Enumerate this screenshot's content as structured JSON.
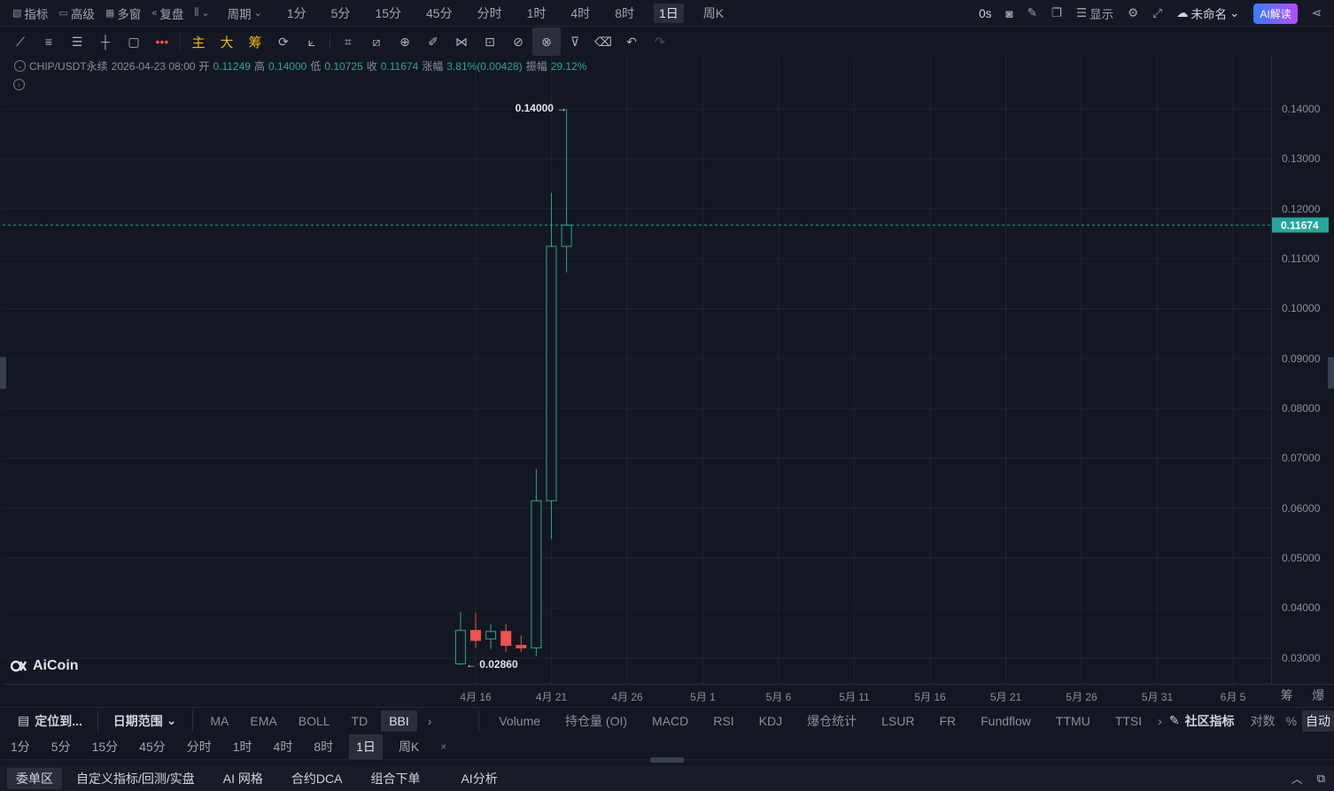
{
  "topbar": {
    "indicators_label": "指标",
    "advanced_label": "高级",
    "multiwindow_label": "多窗",
    "replay_label": "复盘",
    "period_label": "周期",
    "periods": [
      "1分",
      "5分",
      "15分",
      "45分",
      "分时",
      "1时",
      "4时",
      "8时",
      "1日",
      "周K"
    ],
    "active_period": "1日",
    "timer": "0s",
    "display_label": "显示",
    "layout_name": "未命名",
    "ai_button": "AI解读"
  },
  "drawbar": {
    "cn_tools": [
      "主",
      "大",
      "筹"
    ]
  },
  "legend": {
    "symbol": "CHIP/USDT永续",
    "datetime": "2026-04-23 08:00",
    "open_label": "开",
    "open": "0.11249",
    "high_label": "高",
    "high": "0.14000",
    "low_label": "低",
    "low": "0.10725",
    "close_label": "收",
    "close": "0.11674",
    "change_label": "涨幅",
    "change": "3.81%(0.00428)",
    "amp_label": "振幅",
    "amp": "29.12%"
  },
  "chart_data": {
    "type": "candlestick",
    "symbol": "CHIP/USDT永续",
    "interval": "1日",
    "y_ticks": [
      "0.14000",
      "0.13000",
      "0.12000",
      "0.11000",
      "0.10000",
      "0.09000",
      "0.08000",
      "0.07000",
      "0.06000",
      "0.05000",
      "0.04000",
      "0.03000"
    ],
    "ylim": [
      0.0248,
      0.1505
    ],
    "x_ticks": [
      "4月 16",
      "4月 21",
      "4月 26",
      "5月 1",
      "5月 6",
      "5月 11",
      "5月 16",
      "5月 21",
      "5月 26",
      "5月 31",
      "6月 5"
    ],
    "candles": [
      {
        "date": "2026-04-15",
        "open": 0.0288,
        "high": 0.0392,
        "low": 0.0286,
        "close": 0.0355
      },
      {
        "date": "2026-04-16",
        "open": 0.0355,
        "high": 0.039,
        "low": 0.032,
        "close": 0.0335
      },
      {
        "date": "2026-04-17",
        "open": 0.0338,
        "high": 0.0368,
        "low": 0.0318,
        "close": 0.0353
      },
      {
        "date": "2026-04-18",
        "open": 0.0353,
        "high": 0.0368,
        "low": 0.0312,
        "close": 0.0325
      },
      {
        "date": "2026-04-19",
        "open": 0.0325,
        "high": 0.0345,
        "low": 0.0312,
        "close": 0.032
      },
      {
        "date": "2026-04-20",
        "open": 0.032,
        "high": 0.0678,
        "low": 0.0303,
        "close": 0.0615
      },
      {
        "date": "2026-04-21",
        "open": 0.0615,
        "high": 0.1232,
        "low": 0.0538,
        "close": 0.1125
      },
      {
        "date": "2026-04-22",
        "open": 0.11249,
        "high": 0.14,
        "low": 0.10725,
        "close": 0.11674
      }
    ],
    "last_price": "0.11674",
    "max_label": "0.14000",
    "min_label": "0.02860",
    "up_color": "#26a69a",
    "down_color": "#ef5350"
  },
  "watermark": "AiCoin",
  "xaxis_right": [
    "筹",
    "爆"
  ],
  "indicator_bar": {
    "locate": "定位到...",
    "date_range": "日期范围",
    "main_indicators": [
      "MA",
      "EMA",
      "BOLL",
      "TD",
      "BBI"
    ],
    "active_main": "BBI",
    "sub_indicators": [
      "Volume",
      "持仓量 (OI)",
      "MACD",
      "RSI",
      "KDJ",
      "爆仓统计",
      "LSUR",
      "FR",
      "Fundflow",
      "TTMU",
      "TTSI"
    ],
    "community": "社区指标",
    "log": "对数",
    "percent": "%",
    "auto": "自动"
  },
  "period_bar": {
    "periods": [
      "1分",
      "5分",
      "15分",
      "45分",
      "分时",
      "1时",
      "4时",
      "8时",
      "1日",
      "周K"
    ],
    "active": "1日",
    "close": "×"
  },
  "bottom_tabs": {
    "tabs": [
      "委单区",
      "自定义指标/回测/实盘",
      "AI 网格",
      "合约DCA",
      "组合下单",
      "AI分析"
    ],
    "active": "委单区"
  }
}
